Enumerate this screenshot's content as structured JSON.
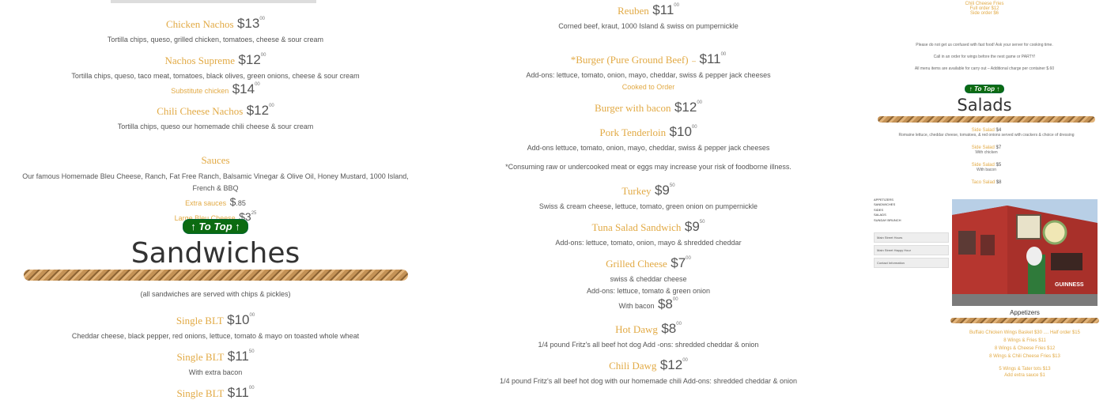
{
  "left": {
    "items": [
      {
        "name": "Chicken Nachos",
        "price": "$13",
        "cents": "00",
        "desc": "Tortilla chips, queso, grilled chicken, tomatoes, cheese & sour cream"
      },
      {
        "name": "Nachos Supreme",
        "price": "$12",
        "cents": "00",
        "desc": "Tortilla chips, queso, taco meat, tomatoes, black olives, green onions, cheese & sour cream"
      },
      {
        "name": "Chili Cheese Nachos",
        "price": "$12",
        "cents": "00",
        "desc": "Tortilla chips, queso our homemade chili cheese & sour cream"
      }
    ],
    "substitute": {
      "label": "Substitute chicken",
      "price": "$14",
      "cents": "00"
    },
    "sauces": {
      "title": "Sauces",
      "desc": "Our famous Homemade Bleu Cheese, Ranch, Fat Free Ranch, Balsamic Vinegar & Olive Oil, Honey Mustard, 1000 Island, French & BBQ",
      "extra_label": "Extra sauces",
      "extra_price": "$",
      "extra_cents": ".85",
      "large_label": "Large Bleu Cheese",
      "large_price": "$3",
      "large_cents": "25"
    },
    "to_top": "To Top",
    "sandwiches_title": "Sandwiches",
    "sandwiches_note": "(all sandwiches are served with chips & pickles)",
    "blt": [
      {
        "name": "Single BLT",
        "price": "$10",
        "cents": "00",
        "desc": "Cheddar cheese, black pepper, red onions, lettuce, tomato & mayo on toasted whole wheat"
      },
      {
        "name": "Single BLT",
        "price": "$11",
        "cents": "50",
        "desc": "With extra bacon"
      },
      {
        "name": "Single BLT",
        "price": "$11",
        "cents": "00",
        "desc": ""
      }
    ]
  },
  "mid": {
    "reuben": {
      "name": "Reuben",
      "price": "$11",
      "cents": "00",
      "desc": "Corned beef, kraut, 1000 Island & swiss on pumpernickle"
    },
    "burger": {
      "name": "*Burger (Pure Ground Beef)",
      "dash": "–",
      "price": "$11",
      "cents": "00",
      "desc": "Add-ons: lettuce, tomato, onion, mayo, cheddar, swiss & pepper jack cheeses",
      "sub": "Cooked to Order"
    },
    "burger_bacon": {
      "name": "Burger with bacon",
      "price": "$12",
      "cents": "00"
    },
    "pork": {
      "name": "Pork Tenderloin",
      "price": "$10",
      "cents": "00",
      "desc": "Add-ons lettuce, tomato, onion, mayo, cheddar, swiss & pepper jack cheeses"
    },
    "warning": "*Consuming raw or undercooked meat or eggs may increase your risk of foodborne illness.",
    "turkey": {
      "name": "Turkey",
      "price": "$9",
      "cents": "50",
      "desc": "Swiss & cream cheese, lettuce, tomato, green onion on pumpernickle"
    },
    "tuna": {
      "name": "Tuna Salad Sandwich",
      "price": "$9",
      "cents": "50",
      "desc": "Add-ons: lettuce, tomato, onion, mayo & shredded cheddar"
    },
    "grilled": {
      "name": "Grilled Cheese",
      "price": "$7",
      "cents": "00",
      "desc1": "swiss & cheddar cheese",
      "desc2": "Add-ons: lettuce, tomato & green onion",
      "bacon_label": "With bacon",
      "bacon_price": "$8",
      "bacon_cents": "00"
    },
    "hotdawg": {
      "name": "Hot Dawg",
      "price": "$8",
      "cents": "00",
      "desc": "1/4 pound Fritz's all beef hot dog Add -ons: shredded cheddar & onion"
    },
    "chilidawg": {
      "name": "Chili Dawg",
      "price": "$12",
      "cents": "00",
      "desc": "1/4 pound Fritz's all beef hot dog with our homemade chili Add-ons: shredded cheddar & onion"
    }
  },
  "right": {
    "fries": {
      "name": "Chili Cheese Fries",
      "full": "Full order $12",
      "side": "Side order $6"
    },
    "notes": [
      "Please do not get us confused with fast food! Ask your server for cooking time.",
      "Call in an order for wings before the next game or PARTY!",
      "All menu items are available for carry out – Additional charge per container $.60"
    ],
    "to_top": "To Top",
    "salads_title": "Salads",
    "salads": [
      {
        "name": "Side Salad",
        "price": "$4",
        "desc": "Romaine lettuce, cheddar cheese, tomatoes, & red onions served with crackers & choice of dressing"
      },
      {
        "name": "Side Salad",
        "price": "$7",
        "desc": "With chicken"
      },
      {
        "name": "Side Salad",
        "price": "$5",
        "desc": "With bacon"
      },
      {
        "name": "Taco Salad",
        "price": "$8",
        "desc": ""
      }
    ],
    "nav_items": [
      "APPETIZERS",
      "SANDWICHES",
      "SIDES",
      "SALADS",
      "SUNDAY BRUNCH"
    ],
    "buttons": [
      "Main Street Hours",
      "Main Street Happy Hour",
      "Contact Information"
    ],
    "appetizers_title": "Appetizers",
    "appetizers": [
      "Buffalo Chicken Wings Basket $30 .... Half order $15",
      "8 Wings & Fries $11",
      "8 Wings & Cheese Fries $12",
      "8 Wings & Chili Cheese Fries $13",
      "5 Wings & Tater tots $13",
      "Add extra sauce $1"
    ],
    "building_sign": "GUINNESS",
    "colors": {
      "gold": "#e2aa45",
      "green": "#0c6b11",
      "building": "#b0322a"
    }
  }
}
